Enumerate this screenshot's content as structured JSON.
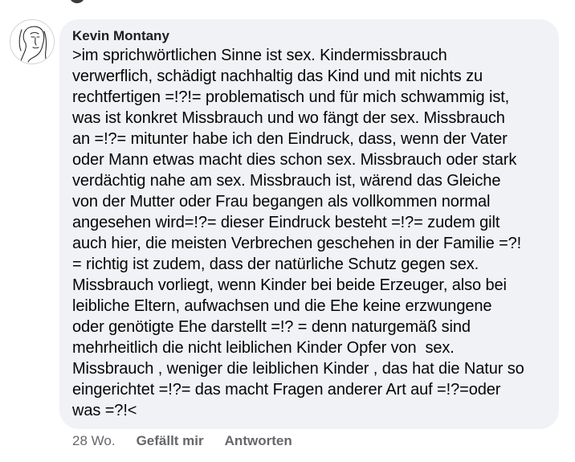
{
  "comment": {
    "author": "Kevin Montany",
    "lines": [
      ">im sprichwörtlichen Sinne ist sex. Kindermissbrauch",
      "verwerflich, schädigt nachhaltig das Kind und mit nichts zu",
      "rechtfertigen =!?!= problematisch und für mich schwammig ist,",
      "was ist konkret Missbrauch und wo fängt der sex. Missbrauch",
      "an =!?= mitunter habe ich den Eindruck, dass, wenn der Vater",
      "oder Mann etwas macht dies schon sex. Missbrauch oder stark",
      "verdächtig nahe am sex. Missbrauch ist, wärend das Gleiche",
      "von der Mutter oder Frau begangen als vollkommen normal",
      "angesehen wird=!?= dieser Eindruck besteht =!?= zudem gilt",
      "auch hier, die meisten Verbrechen geschehen in der Familie =?!",
      "= richtig ist zudem, dass der natürliche Schutz gegen sex.",
      "Missbrauch vorliegt, wenn Kinder bei beide Erzeuger, also bei",
      "leibliche Eltern, aufwachsen und die Ehe keine erzwungene",
      "oder genötigte Ehe darstellt =!? = denn naturgemäß sind",
      "mehrheitlich die nicht leiblichen Kinder Opfer von  sex.",
      "Missbrauch , weniger die leiblichen Kinder , das hat die Natur so",
      "eingerichtet =!?= das macht Fragen anderer Art auf =!?=oder",
      "was =?!<"
    ],
    "avatar_icon": "sketch-face-avatar-icon",
    "bubble_color": "#f0f2f5"
  },
  "actions": {
    "timestamp": "28 Wo.",
    "like_label": "Gefällt mir",
    "reply_label": "Antworten"
  }
}
